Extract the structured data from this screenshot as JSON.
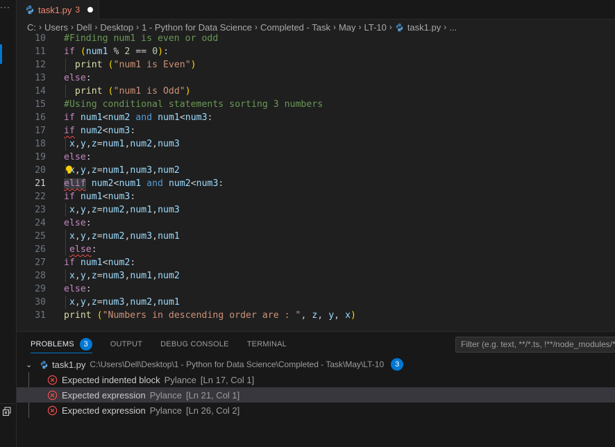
{
  "activity_bar": {
    "more_label": "···"
  },
  "tab": {
    "filename": "task1.py",
    "error_count": "3",
    "modified": true
  },
  "breadcrumb": {
    "items": [
      "C:",
      "Users",
      "Dell",
      "Desktop",
      "1 - Python for Data Science",
      "Completed - Task",
      "May",
      "LT-10"
    ],
    "file": "task1.py",
    "trailing": "..."
  },
  "editor": {
    "current_line": 21,
    "lines": [
      {
        "n": "10",
        "text": "#Finding num1 is even or odd"
      },
      {
        "n": "11",
        "text": "if (num1 % 2 == 0):"
      },
      {
        "n": "12",
        "text": "  print (\"num1 is Even\")"
      },
      {
        "n": "13",
        "text": "else:"
      },
      {
        "n": "14",
        "text": "  print (\"num1 is Odd\")"
      },
      {
        "n": "15",
        "text": "#Using conditional statements sorting 3 numbers"
      },
      {
        "n": "16",
        "text": "if num1<num2 and num1<num3:"
      },
      {
        "n": "17",
        "text": "if num2<num3:"
      },
      {
        "n": "18",
        "text": " x,y,z=num1,num2,num3"
      },
      {
        "n": "19",
        "text": "else:"
      },
      {
        "n": "20",
        "text": " x,y,z=num1,num3,num2"
      },
      {
        "n": "21",
        "text": "elif num2<num1 and num2<num3:"
      },
      {
        "n": "22",
        "text": "if num1<num3:"
      },
      {
        "n": "23",
        "text": " x,y,z=num2,num1,num3"
      },
      {
        "n": "24",
        "text": "else:"
      },
      {
        "n": "25",
        "text": " x,y,z=num2,num3,num1"
      },
      {
        "n": "26",
        "text": " else:"
      },
      {
        "n": "27",
        "text": "if num1<num2:"
      },
      {
        "n": "28",
        "text": " x,y,z=num3,num1,num2"
      },
      {
        "n": "29",
        "text": "else:"
      },
      {
        "n": "30",
        "text": " x,y,z=num3,num2,num1"
      },
      {
        "n": "31",
        "text": "print (\"Numbers in descending order are : \", z, y, x)"
      }
    ]
  },
  "panel": {
    "tabs": [
      {
        "label": "PROBLEMS",
        "badge": "3",
        "active": true
      },
      {
        "label": "OUTPUT"
      },
      {
        "label": "DEBUG CONSOLE"
      },
      {
        "label": "TERMINAL"
      }
    ],
    "filter_placeholder": "Filter (e.g. text, **/*.ts, !**/node_modules/**)",
    "problems_file": {
      "name": "task1.py",
      "path": "C:\\Users\\Dell\\Desktop\\1 - Python for Data Science\\Completed - Task\\May\\LT-10",
      "count": "3"
    },
    "problems": [
      {
        "message": "Expected indented block",
        "source": "Pylance",
        "location": "[Ln 17, Col 1]"
      },
      {
        "message": "Expected expression",
        "source": "Pylance",
        "location": "[Ln 21, Col 1]",
        "selected": true
      },
      {
        "message": "Expected expression",
        "source": "Pylance",
        "location": "[Ln 26, Col 2]"
      }
    ]
  },
  "colors": {
    "accent": "#0078d4",
    "error": "#f14c4c",
    "tab_error_text": "#f48771",
    "keyword": "#c586c0",
    "variable": "#9cdcfe",
    "string": "#ce9178",
    "comment": "#6a9955",
    "function": "#dcdcaa"
  }
}
